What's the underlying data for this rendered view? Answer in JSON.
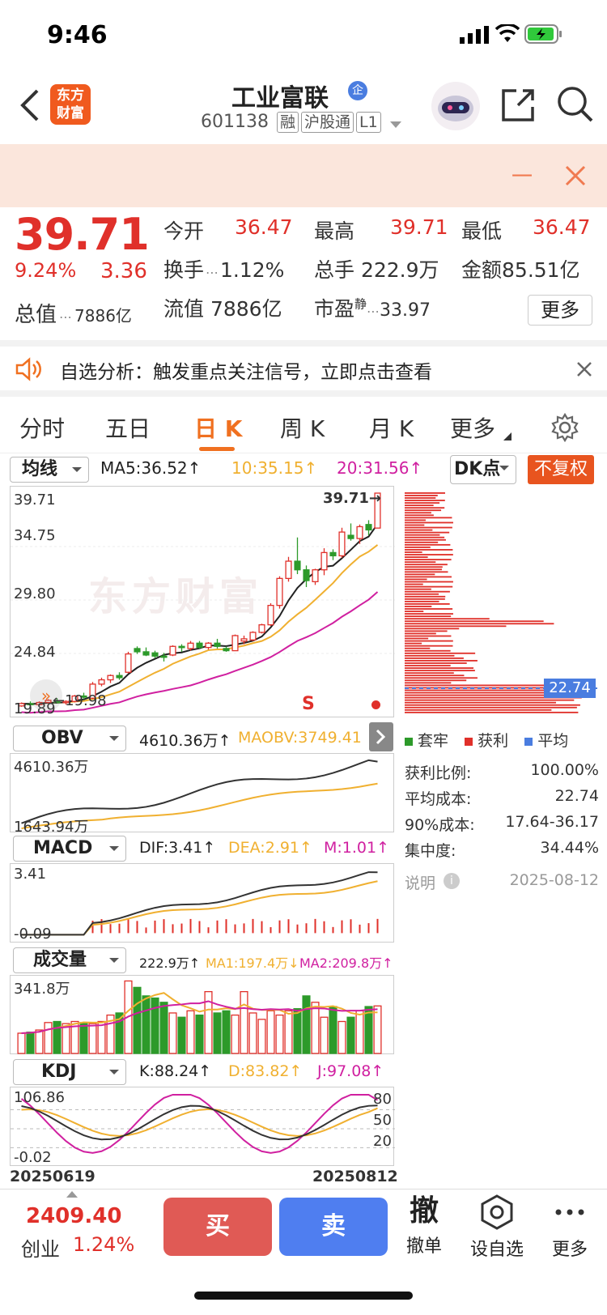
{
  "status_bar": {
    "time": "9:46"
  },
  "header": {
    "logo_text_1": "东方",
    "logo_text_2": "财富",
    "title": "工业富联",
    "title_badge": "企",
    "code": "601138",
    "tags": [
      "融",
      "沪股通",
      "L1"
    ]
  },
  "banner": {
    "text": "一"
  },
  "quote": {
    "price": "39.71",
    "change_pct": "9.24%",
    "change": "3.36",
    "open_label": "今开",
    "open_value": "36.47",
    "high_label": "最高",
    "high_value": "39.71",
    "low_label": "最低",
    "low_value": "36.47",
    "turnover_label": "换手",
    "turnover_value": "1.12%",
    "volume_label": "总手",
    "volume_value": "222.9万",
    "amount_label": "金额",
    "amount_value": "85.51亿",
    "mktcap_label": "总值",
    "mktcap_value": "7886亿",
    "float_label": "流值",
    "float_value": "7886亿",
    "pe_label": "市盈",
    "pe_sup": "静",
    "pe_value": "33.97",
    "more_label": "更多"
  },
  "notice": {
    "text": "自选分析：触发重点关注信号，立即点击查看"
  },
  "tabs": [
    "分时",
    "五日",
    "日 K",
    "周 K",
    "月 K",
    "更多"
  ],
  "active_tab": "日 K",
  "colors": {
    "up": "#e0302a",
    "down": "#2d9a2a",
    "accent": "#f07020",
    "ma5": "#222222",
    "ma10": "#f0b030",
    "ma20": "#d020a0"
  },
  "kline": {
    "ma_select": "均线",
    "ma5": "MA5:36.52↑",
    "ma10": "10:35.15↑",
    "ma20": "20:31.56↑",
    "dk_label": "DK点",
    "fq_label": "不复权",
    "y_labels": [
      "39.71",
      "34.75",
      "29.80",
      "24.84",
      "19.89"
    ],
    "high_marker": "39.71→",
    "low_marker": "←19.98",
    "signal": "S",
    "watermark": "东方财富",
    "avg_cost_tag": "22.74"
  },
  "chart_data": {
    "type": "candlestick",
    "x_start": "20250619",
    "x_end": "20250812",
    "ylim": [
      19.89,
      39.71
    ],
    "candles": [
      [
        19.98,
        20.3,
        19.9,
        20.2
      ],
      [
        20.2,
        20.4,
        20.0,
        20.1
      ],
      [
        20.1,
        20.4,
        19.95,
        20.3
      ],
      [
        20.3,
        20.6,
        20.2,
        20.5
      ],
      [
        20.4,
        20.7,
        20.2,
        20.3
      ],
      [
        20.3,
        20.5,
        20.1,
        20.4
      ],
      [
        20.4,
        21.0,
        20.3,
        20.9
      ],
      [
        20.9,
        21.2,
        20.6,
        20.8
      ],
      [
        20.7,
        22.2,
        20.6,
        22.0
      ],
      [
        22.0,
        22.6,
        21.8,
        22.4
      ],
      [
        22.4,
        22.9,
        22.1,
        22.8
      ],
      [
        22.8,
        23.1,
        22.4,
        22.6
      ],
      [
        23.1,
        25.0,
        23.0,
        24.8
      ],
      [
        25.3,
        25.5,
        24.8,
        25.0
      ],
      [
        25.0,
        25.4,
        24.6,
        24.7
      ],
      [
        24.9,
        25.1,
        24.4,
        24.6
      ],
      [
        24.6,
        24.9,
        24.1,
        24.5
      ],
      [
        24.7,
        25.6,
        24.6,
        25.5
      ],
      [
        25.5,
        25.7,
        25.0,
        25.4
      ],
      [
        25.3,
        26.0,
        25.1,
        25.8
      ],
      [
        25.8,
        26.0,
        25.3,
        25.4
      ],
      [
        25.4,
        25.9,
        25.2,
        25.8
      ],
      [
        25.8,
        26.2,
        25.3,
        25.5
      ],
      [
        25.3,
        25.5,
        25.0,
        25.1
      ],
      [
        25.1,
        26.6,
        25.1,
        26.5
      ],
      [
        26.0,
        26.5,
        25.7,
        26.2
      ],
      [
        26.1,
        26.9,
        26.0,
        26.8
      ],
      [
        26.8,
        27.6,
        26.7,
        27.5
      ],
      [
        27.5,
        29.5,
        27.4,
        29.3
      ],
      [
        29.3,
        32.0,
        29.0,
        31.8
      ],
      [
        31.8,
        33.8,
        31.5,
        33.4
      ],
      [
        33.4,
        35.6,
        32.2,
        32.6
      ],
      [
        32.6,
        33.0,
        31.0,
        31.6
      ],
      [
        31.5,
        32.7,
        31.2,
        32.6
      ],
      [
        32.6,
        34.6,
        32.1,
        34.2
      ],
      [
        34.2,
        34.5,
        33.5,
        33.9
      ],
      [
        33.9,
        36.5,
        33.7,
        36.1
      ],
      [
        35.8,
        36.9,
        35.3,
        35.5
      ],
      [
        35.5,
        36.8,
        35.0,
        36.6
      ],
      [
        36.8,
        37.2,
        35.8,
        36.3
      ],
      [
        36.47,
        39.71,
        36.47,
        39.71
      ]
    ],
    "ma5_label": "MA5:36.52",
    "obv": {
      "label": "OBV",
      "value": "4610.36万↑",
      "maobv": "MAOBV:3749.41",
      "y_labels": [
        "4610.36万",
        "1643.94万"
      ]
    },
    "macd": {
      "label": "MACD",
      "dif": "DIF:3.41↑",
      "dea": "DEA:2.91↑",
      "m": "M:1.01↑",
      "y_labels": [
        "3.41",
        "-0.09"
      ]
    },
    "volume": {
      "label": "成交量",
      "value": "222.9万↑",
      "ma1": "MA1:197.4万↓",
      "ma2": "MA2:209.8万↑",
      "y_labels": [
        "341.8万"
      ]
    },
    "kdj": {
      "label": "KDJ",
      "k": "K:88.24↑",
      "d": "D:83.82↑",
      "j": "J:97.08↑",
      "y_labels": [
        "106.86",
        "-0.02"
      ],
      "levels": [
        "80",
        "50",
        "20"
      ]
    },
    "volume_values": [
      95,
      100,
      110,
      145,
      150,
      140,
      150,
      145,
      140,
      150,
      180,
      190,
      340,
      310,
      270,
      260,
      240,
      190,
      170,
      200,
      180,
      290,
      190,
      200,
      180,
      290,
      190,
      160,
      200,
      180,
      200,
      210,
      270,
      240,
      170,
      220,
      150,
      170,
      200,
      220,
      222.9
    ]
  },
  "chip": {
    "legend": [
      "套牢",
      "获利",
      "平均"
    ],
    "profit_ratio_label": "获利比例:",
    "profit_ratio": "100.00%",
    "avg_cost_label": "平均成本:",
    "avg_cost": "22.74",
    "cost90_label": "90%成本:",
    "cost90": "17.64-36.17",
    "concentration_label": "集中度:",
    "concentration": "34.44%",
    "note_label": "说明",
    "date": "2025-08-12"
  },
  "bottom": {
    "index_value": "2409.40",
    "index_name": "创业",
    "index_change": "1.24%",
    "buy": "买",
    "sell": "卖",
    "cancel_icon_char": "撤",
    "cancel_label": "撤单",
    "watch_label": "设自选",
    "more_label": "更多"
  }
}
